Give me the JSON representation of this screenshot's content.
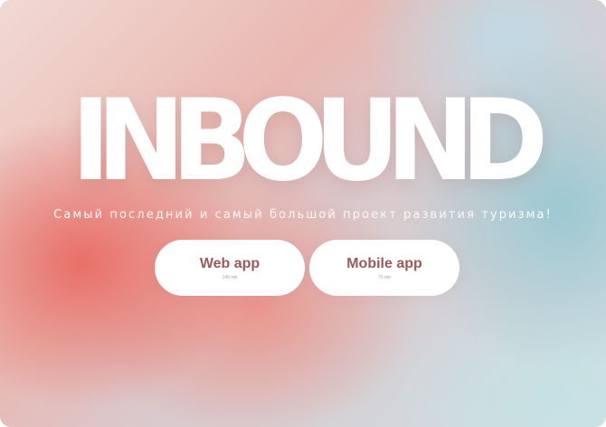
{
  "brand": {
    "title": "INBOUND",
    "tagline": "Самый последний и самый большой проект развития туризма!"
  },
  "actions": {
    "web": {
      "label": "Web app",
      "size": "145 mb"
    },
    "mobile": {
      "label": "Mobile app",
      "size": "76 mb"
    }
  },
  "colors": {
    "button_text": "#9b5a57",
    "button_bg": "#ffffff",
    "warm_accent": "#e86c64",
    "cool_accent": "#96c8d2"
  }
}
